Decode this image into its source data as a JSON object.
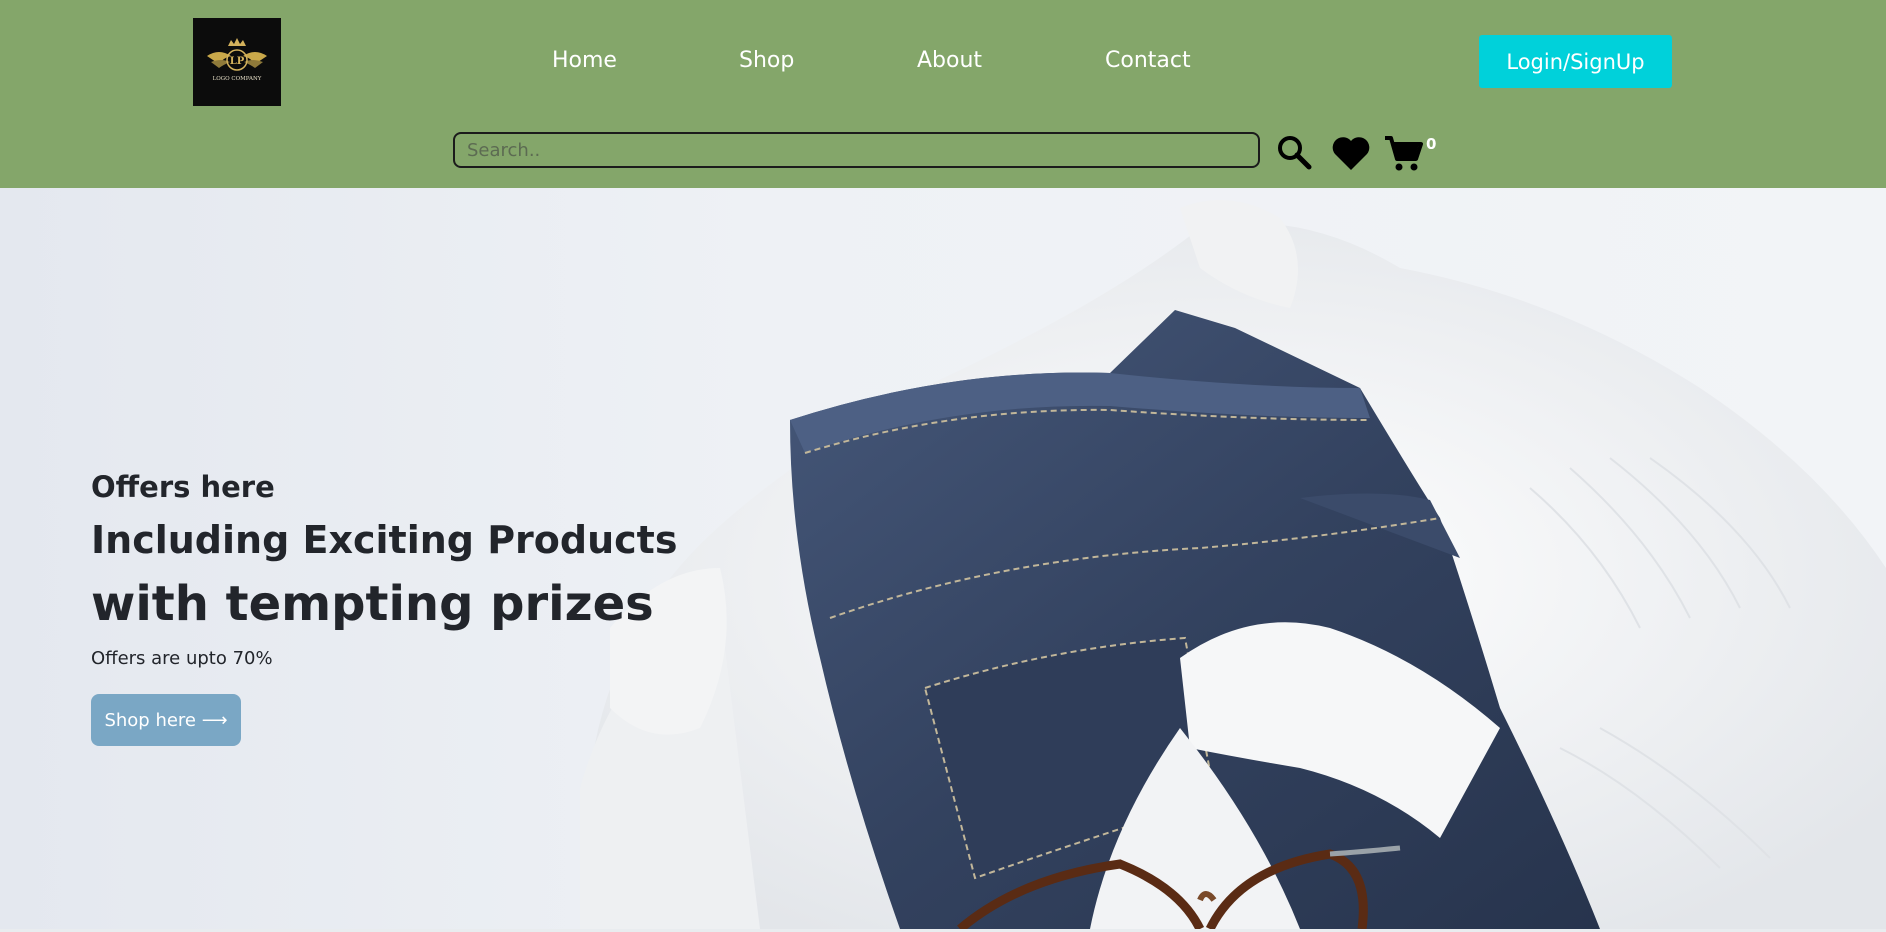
{
  "header": {
    "logo_text": "LOGO COMPANY",
    "logo_monogram": "LP",
    "nav": [
      {
        "label": "Home"
      },
      {
        "label": "Shop"
      },
      {
        "label": "About"
      },
      {
        "label": "Contact"
      }
    ],
    "login_label": "Login/SignUp",
    "search": {
      "placeholder": "Search..",
      "value": ""
    },
    "cart_count": "0"
  },
  "hero": {
    "offers_label": "Offers here",
    "headline_1": "Including Exciting Products",
    "headline_2": "with tempting prizes",
    "offer_note": "Offers are upto 70%",
    "shop_button": "Shop here ⟶"
  },
  "colors": {
    "header_bg": "#84a66a",
    "login_bg": "#00d1da",
    "shop_button_bg": "#7aa7c5"
  },
  "icons": [
    "search-icon",
    "heart-icon",
    "cart-icon"
  ]
}
